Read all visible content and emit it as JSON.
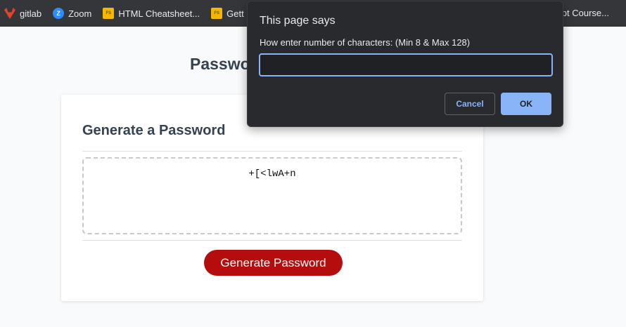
{
  "bookmarks": [
    {
      "label": "gitlab",
      "icon": "gitlab-icon"
    },
    {
      "label": "Zoom",
      "icon": "zoom-icon"
    },
    {
      "label": "HTML Cheatsheet...",
      "icon": "fs-icon"
    },
    {
      "label": "Gett",
      "icon": "fs-icon"
    }
  ],
  "bookmark_right": "cript Course...",
  "page": {
    "title": "Passwo",
    "card_title": "Generate a Password",
    "password": "+[<lwA+n",
    "generate_label": "Generate Password"
  },
  "dialog": {
    "title": "This page says",
    "message": "How enter number of characters: (Min 8 & Max 128)",
    "value": "",
    "cancel": "Cancel",
    "ok": "OK"
  },
  "colors": {
    "accent": "#b50d0d",
    "dialog_accent": "#8ab4f8"
  }
}
